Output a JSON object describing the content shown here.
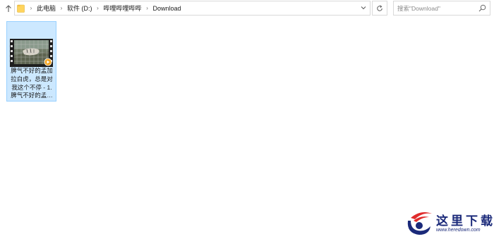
{
  "nav": {
    "breadcrumbs": [
      "此电脑",
      "软件 (D:)",
      "哔哩哔哩哔哔",
      "Download"
    ],
    "search_placeholder": "搜索\"Download\""
  },
  "files": [
    {
      "name": "脾气不好的孟加拉白虎，总是对我这个不停 - 1.脾气不好的孟…",
      "type": "video",
      "selected": true
    }
  ],
  "watermark": {
    "brand": "这里下载",
    "url": "www.heredown.com"
  },
  "colors": {
    "selection_fill": "#cce8ff",
    "selection_border": "#99d1ff",
    "folder_yellow": "#ffd45c",
    "logo_blue": "#1b2a7a",
    "logo_red": "#e02b2b"
  }
}
